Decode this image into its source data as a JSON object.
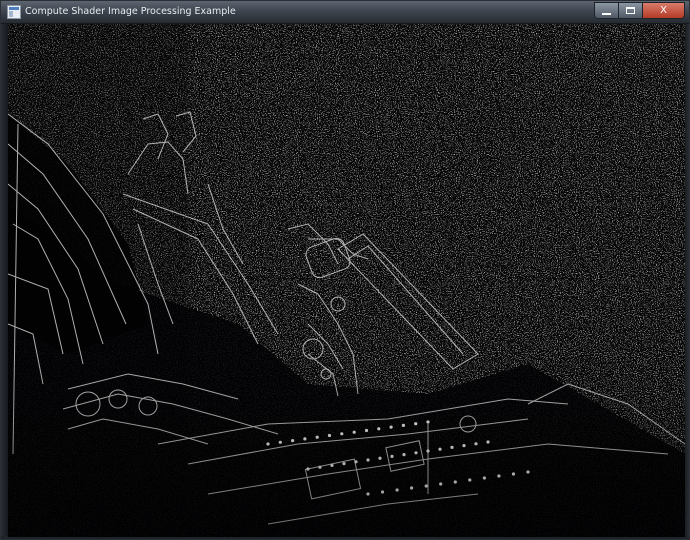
{
  "window": {
    "title": "Compute Shader Image Processing Example",
    "icon": "app-icon",
    "controls": {
      "minimize": "minimize-icon",
      "maximize": "maximize-icon",
      "close_label": "X"
    }
  },
  "viewport": {
    "content": "edge-detected image of a rover on gravel terrain",
    "colors": {
      "background": "#050506",
      "edges": "#d8d8d8",
      "noise": "#6a6a6a"
    }
  }
}
